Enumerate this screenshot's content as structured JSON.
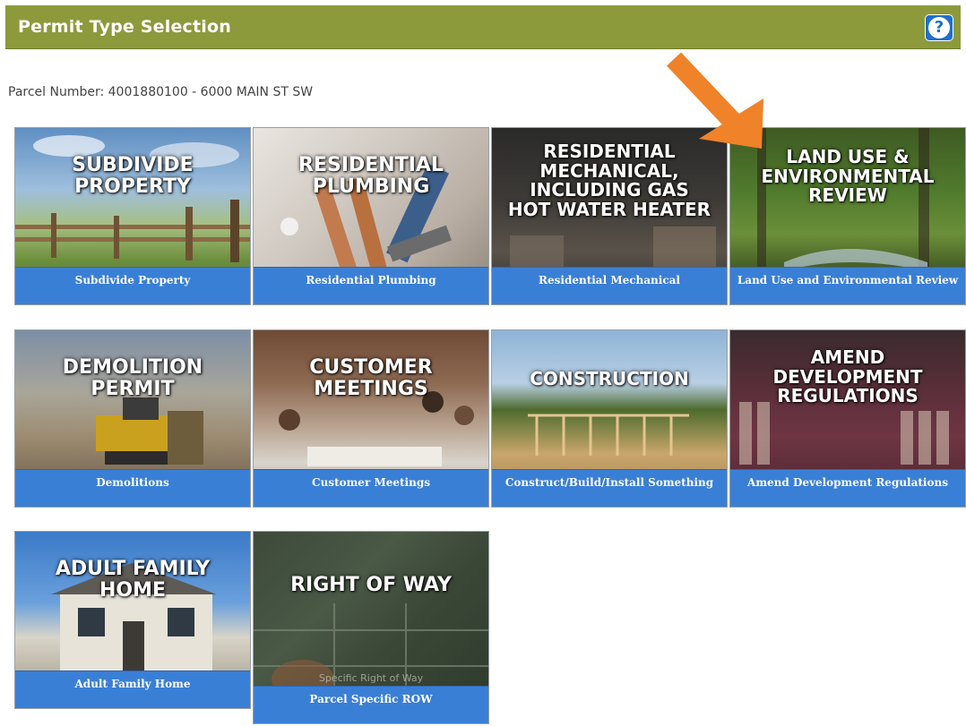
{
  "header": {
    "title": "Permit Type Selection",
    "help_icon": "question-circle-icon",
    "help_label": "?"
  },
  "parcel": {
    "text": "Parcel Number: 4001880100 - 6000 MAIN ST SW"
  },
  "tiles": [
    {
      "id": "subdivide",
      "big": "SUBDIVIDE\nPROPERTY",
      "caption": "Subdivide Property"
    },
    {
      "id": "res-plumbing",
      "big": "RESIDENTIAL\nPLUMBING",
      "caption": "Residential Plumbing"
    },
    {
      "id": "res-mechanical",
      "big": "RESIDENTIAL\nMECHANICAL,\nINCLUDING GAS\nHOT WATER HEATER",
      "caption": "Residential Mechanical"
    },
    {
      "id": "land-use",
      "big": "LAND USE &\nENVIRONMENTAL\nREVIEW",
      "caption": "Land Use and Environmental Review"
    },
    {
      "id": "demolition",
      "big": "DEMOLITION\nPERMIT",
      "caption": "Demolitions"
    },
    {
      "id": "customer-meetings",
      "big": "CUSTOMER\nMEETINGS",
      "caption": "Customer Meetings"
    },
    {
      "id": "construction",
      "big": "CONSTRUCTION",
      "caption": "Construct/Build/Install Something"
    },
    {
      "id": "amend-dev",
      "big": "AMEND\nDEVELOPMENT\nREGULATIONS",
      "caption": "Amend Development Regulations"
    },
    {
      "id": "adult-family",
      "big": "ADULT FAMILY\nHOME",
      "caption": "Adult Family Home"
    },
    {
      "id": "right-of-way",
      "big": "RIGHT OF WAY",
      "sub": "Specific Right of Way",
      "caption": "Parcel Specific ROW"
    }
  ],
  "colors": {
    "header": "#8c9a3b",
    "caption": "#3a7fd6",
    "arrow": "#f0822a"
  }
}
